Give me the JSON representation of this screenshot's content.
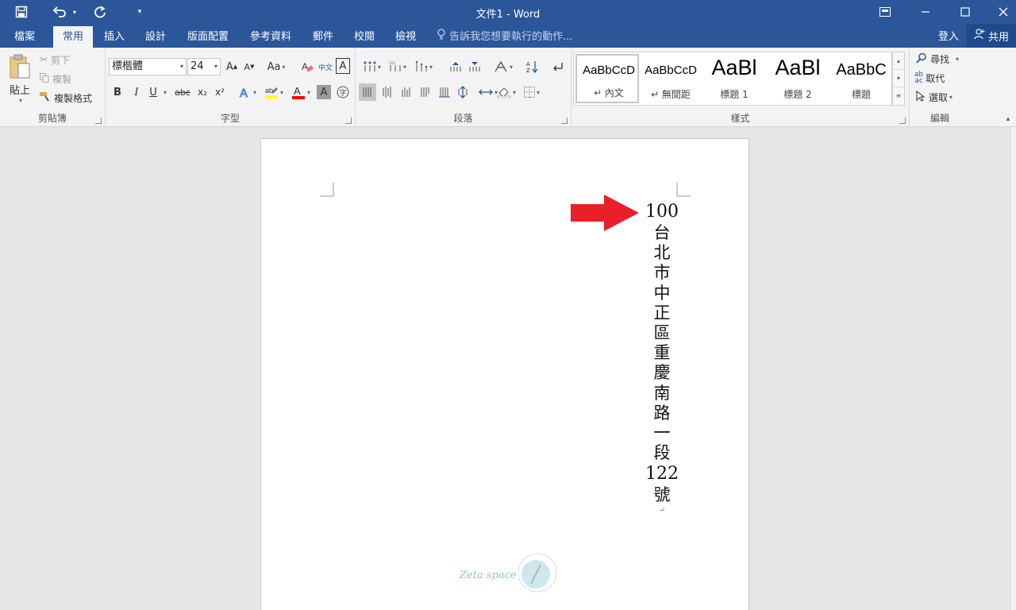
{
  "window": {
    "title": "文件1 - Word",
    "quick_access": [
      "save-icon",
      "undo-icon",
      "redo-icon",
      "customize-icon"
    ]
  },
  "tabs": [
    {
      "label": "檔案",
      "active": false
    },
    {
      "label": "常用",
      "active": true
    },
    {
      "label": "插入",
      "active": false
    },
    {
      "label": "設計",
      "active": false
    },
    {
      "label": "版面配置",
      "active": false
    },
    {
      "label": "參考資料",
      "active": false
    },
    {
      "label": "郵件",
      "active": false
    },
    {
      "label": "校閱",
      "active": false
    },
    {
      "label": "檢視",
      "active": false
    }
  ],
  "tell_me": "告訴我您想要執行的動作...",
  "account": {
    "sign_in": "登入",
    "share": "共用"
  },
  "ribbon": {
    "clipboard": {
      "label": "剪貼簿",
      "paste": "貼上",
      "cut": "剪下",
      "copy": "複製",
      "format_painter": "複製格式"
    },
    "font": {
      "label": "字型",
      "font_name": "標楷體",
      "font_size": "24",
      "case_button": "Aa",
      "bold": "B",
      "italic": "I",
      "underline": "U",
      "strikethrough": "abc",
      "subscript": "x₂",
      "superscript": "x²",
      "phonetic": "中文",
      "highlight_color": "#ffff00",
      "font_color": "#ff0000"
    },
    "paragraph": {
      "label": "段落"
    },
    "styles": {
      "label": "樣式",
      "items": [
        {
          "sample": "AaBbCcD",
          "name": "↵ 內文",
          "selected": true
        },
        {
          "sample": "AaBbCcD",
          "name": "↵ 無間距",
          "selected": false
        },
        {
          "sample": "AaBl",
          "name": "標題 1",
          "selected": false
        },
        {
          "sample": "AaBl",
          "name": "標題 2",
          "selected": false
        },
        {
          "sample": "AaBbC",
          "name": "標題",
          "selected": false
        }
      ]
    },
    "editing": {
      "label": "編輯",
      "find": "尋找",
      "replace": "取代",
      "select": "選取"
    }
  },
  "document": {
    "postal_code": "100",
    "address_chars": [
      "台",
      "北",
      "市",
      "中",
      "正",
      "區",
      "重",
      "慶",
      "南",
      "路",
      "一",
      "段"
    ],
    "house_number": "122",
    "suffix": "號",
    "paragraph_mark": "↵",
    "watermark": "Zeta space",
    "arrow_color": "#e8202a"
  },
  "colors": {
    "titlebar": "#2b579a",
    "ribbon": "#f3f3f3",
    "canvas": "#e6e6e6"
  }
}
